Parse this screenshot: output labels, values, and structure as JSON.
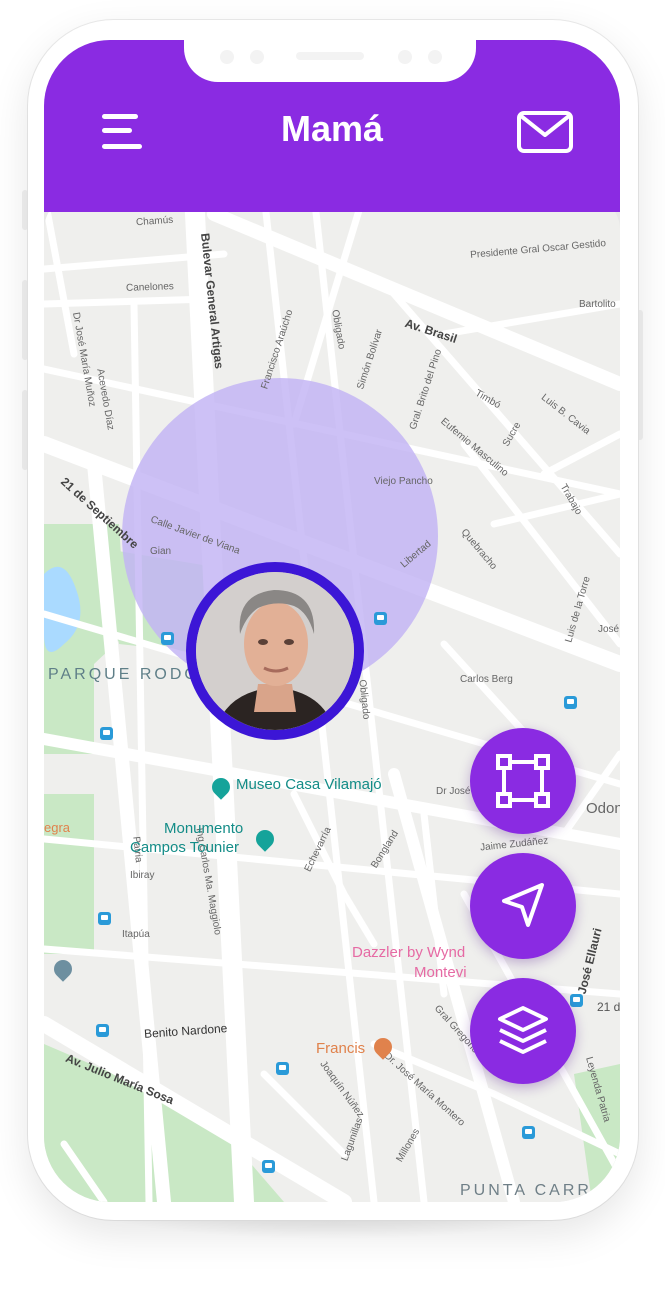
{
  "header": {
    "title": "Mamá",
    "menu_icon": "hamburger-menu-icon",
    "mail_icon": "envelope-icon"
  },
  "colors": {
    "accent": "#8a2be2",
    "avatar_ring": "#3c16d6",
    "radius_fill": "#c2b3f4"
  },
  "map": {
    "park_label": "PARQUE RODÓ",
    "area_label": "PUNTA CARR",
    "pois": {
      "museo": "Museo Casa Vilamajó",
      "monumento_line1": "Monumento",
      "monumento_line2": "Campos Tounier",
      "dazzler_line1": "Dazzler by Wynd",
      "dazzler_line2": "Montevi",
      "francis": "Francis",
      "odon": "Odon",
      "legra": "egra"
    },
    "streets": {
      "chamua": "Chamús",
      "canelones": "Canelones",
      "artigas": "Bulevar General Artigas",
      "presidente": "Presidente Gral Oscar Gestido",
      "bartolito": "Bartolito",
      "brasil": "Av. Brasil",
      "arazati": "Francisco Araúcho",
      "obligado": "Obligado",
      "simon": "Simón Bolívar",
      "brito": "Gral. Brito del Pino",
      "munoz": "Dr José María Muñoz",
      "acevedo": "Acevedo Díaz",
      "timbo": "Timbó",
      "luis": "Luis B. Cavia",
      "eufemio": "Eufemio Masculino",
      "sucre": "Sucre",
      "viejo": "Viejo Pancho",
      "trabajo": "Trabajo",
      "septiembre": "21 de Septiembre",
      "javier": "Calle Javier de Viana",
      "gian": "Gian",
      "libertad": "Libertad",
      "quebracho": "Quebracho",
      "luistorre": "Luis de la Torre",
      "josec": "José",
      "carlosberg": "Carlos Berg",
      "obligado2": "Obligado",
      "drjose": "Dr José",
      "jamez": "Jaime Zudáñez",
      "patria": "Patria",
      "ibiray": "Ibiray",
      "magg": "Ing Carlos Ma. Maggiolo",
      "echeverria": "Echevarría",
      "bongland": "Bongland",
      "itapua": "Itapúa",
      "ellauri": "José Ellauri",
      "p21": "21 d",
      "nardone": "Benito Nardone",
      "julio": "Av. Julio María Sosa",
      "nunez": "Joaquín Núñez",
      "montero": "Dr. José María Montero",
      "gregorio": "Gral Gregorio",
      "leyenda": "Leyenda Patria",
      "laguna": "Lagunillas",
      "millones": "Millones"
    }
  },
  "fabs": [
    {
      "name": "select-area-button",
      "icon": "bounding-box-icon"
    },
    {
      "name": "navigate-button",
      "icon": "navigation-arrow-icon"
    },
    {
      "name": "layers-button",
      "icon": "layers-icon"
    }
  ]
}
